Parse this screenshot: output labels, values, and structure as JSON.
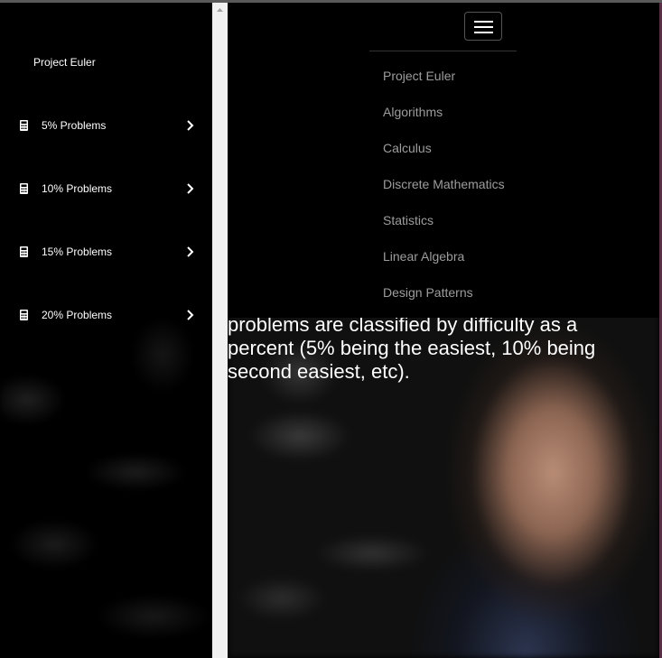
{
  "sidebar": {
    "brand": "Project Euler",
    "items": [
      {
        "label": "5% Problems",
        "icon": "calculator-icon"
      },
      {
        "label": "10% Problems",
        "icon": "calculator-icon"
      },
      {
        "label": "15% Problems",
        "icon": "calculator-icon"
      },
      {
        "label": "20% Problems",
        "icon": "calculator-icon"
      }
    ]
  },
  "navbar": {
    "toggle_icon": "hamburger-icon",
    "links": [
      {
        "label": "Project Euler"
      },
      {
        "label": "Algorithms"
      },
      {
        "label": "Calculus"
      },
      {
        "label": "Discrete Mathematics"
      },
      {
        "label": "Statistics"
      },
      {
        "label": "Linear Algebra"
      },
      {
        "label": "Design Patterns"
      }
    ]
  },
  "main": {
    "text": "problems are classified by difficulty as a percent (5% being the easiest, 10% being second easiest, etc)."
  },
  "colors": {
    "background": "#000000",
    "nav_link": "#9d9d9d",
    "scrollbar": "#f1f1f1"
  }
}
